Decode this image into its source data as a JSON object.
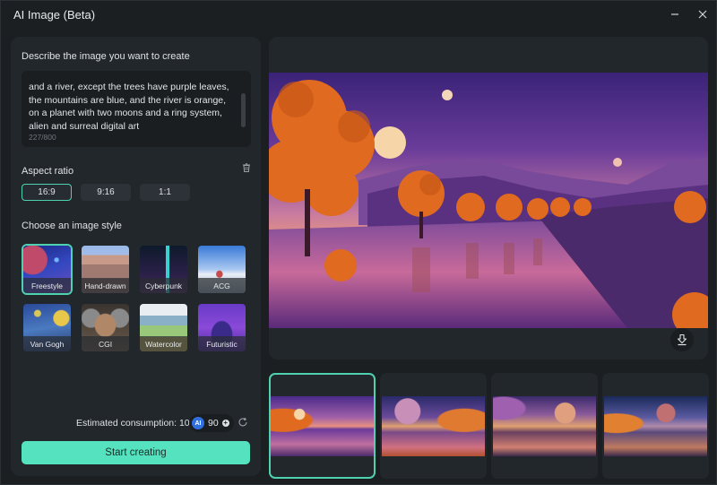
{
  "window": {
    "title": "AI Image (Beta)",
    "minimize_icon": "minimize-icon",
    "close_icon": "close-icon"
  },
  "prompt": {
    "label": "Describe the image you want to create",
    "text": "and a river, except the trees have purple leaves, the mountains are blue, and the river is orange, on a planet with two moons and a ring system, alien and surreal digital art",
    "char_count": "227/800",
    "clear_icon": "trash-icon"
  },
  "aspect_ratio": {
    "label": "Aspect ratio",
    "options": [
      "16:9",
      "9:16",
      "1:1"
    ],
    "selected": "16:9"
  },
  "image_style": {
    "label": "Choose an image style",
    "options": [
      "Freestyle",
      "Hand-drawn",
      "Cyberpunk",
      "ACG",
      "Van Gogh",
      "CGI",
      "Watercolor",
      "Futuristic"
    ],
    "selected": "Freestyle"
  },
  "footer": {
    "consumption_label": "Estimated consumption: 10",
    "ai_badge": "AI",
    "credits": "90",
    "add_credits_icon": "plus-circle-icon",
    "refresh_icon": "refresh-icon",
    "start_button": "Start creating"
  },
  "preview": {
    "download_icon": "download-icon"
  },
  "results": {
    "count": 4,
    "selected_index": 0
  },
  "colors": {
    "accent": "#55e3bf",
    "accent_border": "#4fd1b0",
    "panel": "#22272c",
    "background": "#1b1f22",
    "credit_badge": "#2f6fe0"
  }
}
